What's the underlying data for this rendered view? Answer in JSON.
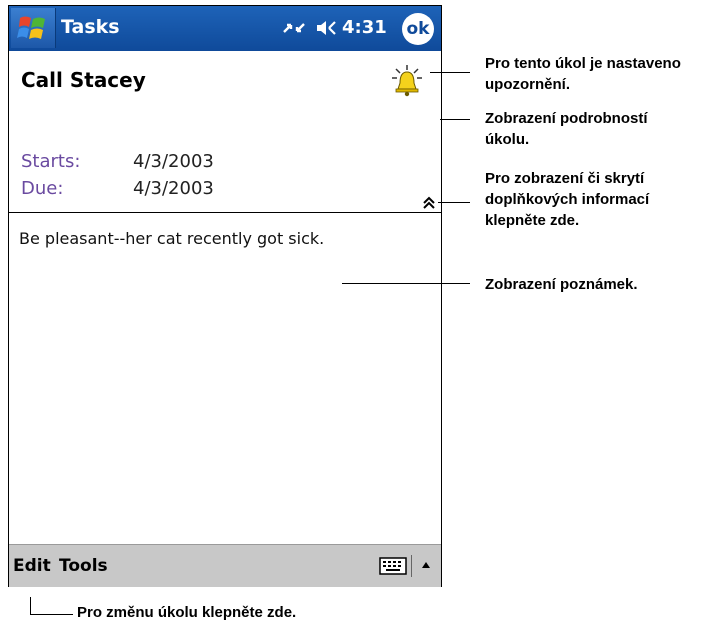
{
  "titlebar": {
    "app_title": "Tasks",
    "clock": "4:31",
    "ok_label": "ok",
    "accent_color": "#1e63b8"
  },
  "task": {
    "subject": "Call Stacey",
    "starts_label": "Starts:",
    "starts_value": "4/3/2003",
    "due_label": "Due:",
    "due_value": "4/3/2003",
    "notes": "Be pleasant--her cat recently got sick."
  },
  "menubar": {
    "edit": "Edit",
    "tools": "Tools"
  },
  "callouts": {
    "reminder": [
      "Pro tento úkol je nastaveno",
      "upozornění."
    ],
    "details": [
      "Zobrazení podrobností",
      "úkolu."
    ],
    "toggle": [
      "Pro zobrazení či skrytí",
      "doplňkových informací",
      "klepněte zde."
    ],
    "notes": [
      "Zobrazení poznámek."
    ],
    "edit_task": "Pro změnu úkolu klepněte zde."
  },
  "icons": {
    "start": "windows-flag-icon",
    "sync": "sync-icon",
    "volume": "speaker-icon",
    "reminder": "bell-icon",
    "collapse": "double-chevron-up-icon",
    "keyboard": "keyboard-icon",
    "sip": "triangle-up-icon"
  }
}
